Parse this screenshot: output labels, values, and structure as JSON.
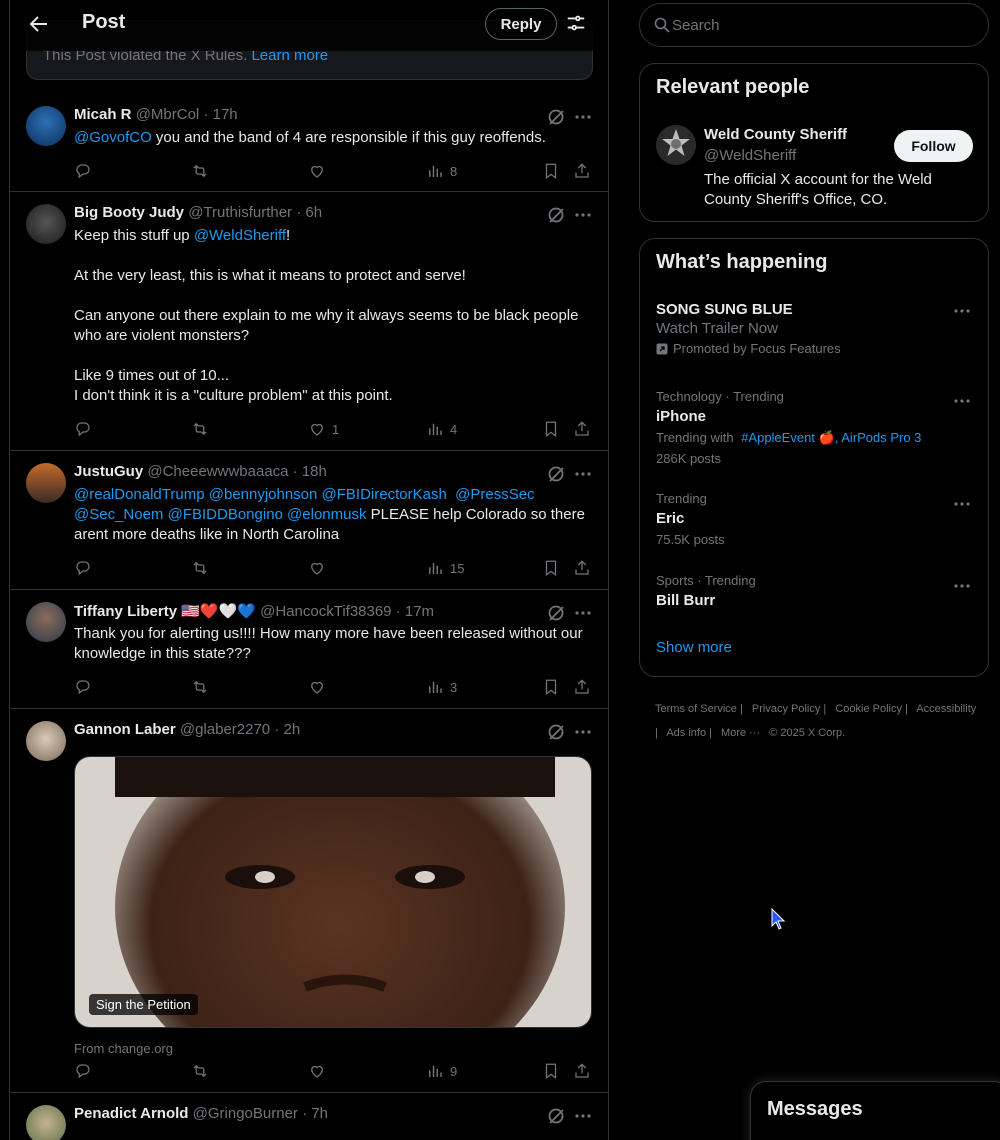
{
  "header": {
    "title": "Post",
    "reply_label": "Reply"
  },
  "violation": {
    "text": "This Post violated the X Rules.",
    "link": "Learn more"
  },
  "tweets": [
    {
      "name": "Micah R",
      "handle": "@MbrCol",
      "time": "· 17h",
      "body_parts": [
        {
          "t": "@GovofCO",
          "link": true
        },
        {
          "t": " you and the band of 4 are responsible if this guy reoffends.",
          "link": false
        }
      ],
      "replies": "",
      "retweets": "",
      "likes": "",
      "views": "8"
    },
    {
      "name": "Big Booty Judy",
      "handle": "@Truthisfurther",
      "time": "· 6h",
      "body_parts": [
        {
          "t": "Keep this stuff up ",
          "link": false
        },
        {
          "t": "@WeldSheriff",
          "link": true
        },
        {
          "t": "!\n\nAt the very least, this is what it means to protect and serve!\n\nCan anyone out there explain to me why it always seems to be black people who are violent monsters?\n\nLike 9 times out of 10...\nI don't think it is a \"culture problem\" at this point.",
          "link": false
        }
      ],
      "replies": "",
      "retweets": "",
      "likes": "1",
      "views": "4"
    },
    {
      "name": "JustuGuy",
      "handle": "@Cheeewwwbaaaca",
      "time": "· 18h",
      "body_parts": [
        {
          "t": "@realDonaldTrump @bennyjohnson @FBIDirectorKash  @PressSec @Sec_Noem @FBIDDBongino @elonmusk",
          "link": true
        },
        {
          "t": " PLEASE help Colorado so there arent more deaths like in North Carolina",
          "link": false
        }
      ],
      "replies": "",
      "retweets": "",
      "likes": "",
      "views": "15"
    },
    {
      "name": "Tiffany Liberty 🇺🇸❤️🤍💙",
      "handle": "@HancockTif38369",
      "time": "· 17m",
      "body_parts": [
        {
          "t": "Thank you for alerting us!!!! How many more have been released without our knowledge in this state???",
          "link": false
        }
      ],
      "replies": "",
      "retweets": "",
      "likes": "",
      "views": "3"
    },
    {
      "name": "Gannon Laber",
      "handle": "@glaber2270",
      "time": "· 2h",
      "body_parts": [],
      "media_label": "Sign the Petition",
      "media_source": "From change.org",
      "replies": "",
      "retweets": "",
      "likes": "",
      "views": "9"
    },
    {
      "name": "Penadict Arnold",
      "handle": "@GringoBurner",
      "time": "· 7h",
      "body_parts": []
    }
  ],
  "search": {
    "placeholder": "Search"
  },
  "relevant": {
    "title": "Relevant people",
    "name": "Weld County Sheriff",
    "handle": "@WeldSheriff",
    "bio": "The official X account for the Weld County Sheriff's Office, CO.",
    "follow_label": "Follow"
  },
  "happening": {
    "title": "What’s happening",
    "promo": {
      "title": "SONG SUNG BLUE",
      "sub": "Watch Trailer Now",
      "promoted": "Promoted by Focus Features"
    },
    "trends": [
      {
        "ctx": "Technology · Trending",
        "title": "iPhone",
        "with_label": "Trending with",
        "with_links": "#AppleEvent 🍎, AirPods Pro 3",
        "posts": "286K posts"
      },
      {
        "ctx": "Trending",
        "title": "Eric",
        "posts": "75.5K posts"
      },
      {
        "ctx": "Sports · Trending",
        "title": "Bill Burr"
      }
    ],
    "show_more": "Show more"
  },
  "footer": [
    "Terms of Service |",
    "Privacy Policy |",
    "Cookie Policy |",
    "Accessibility |",
    "Ads info |",
    "More ···",
    "© 2025 X Corp."
  ],
  "messages": {
    "title": "Messages"
  },
  "colors": {
    "accent": "#1d9bf0",
    "background": "#000000",
    "border": "#2f3336",
    "muted": "#71767b"
  }
}
